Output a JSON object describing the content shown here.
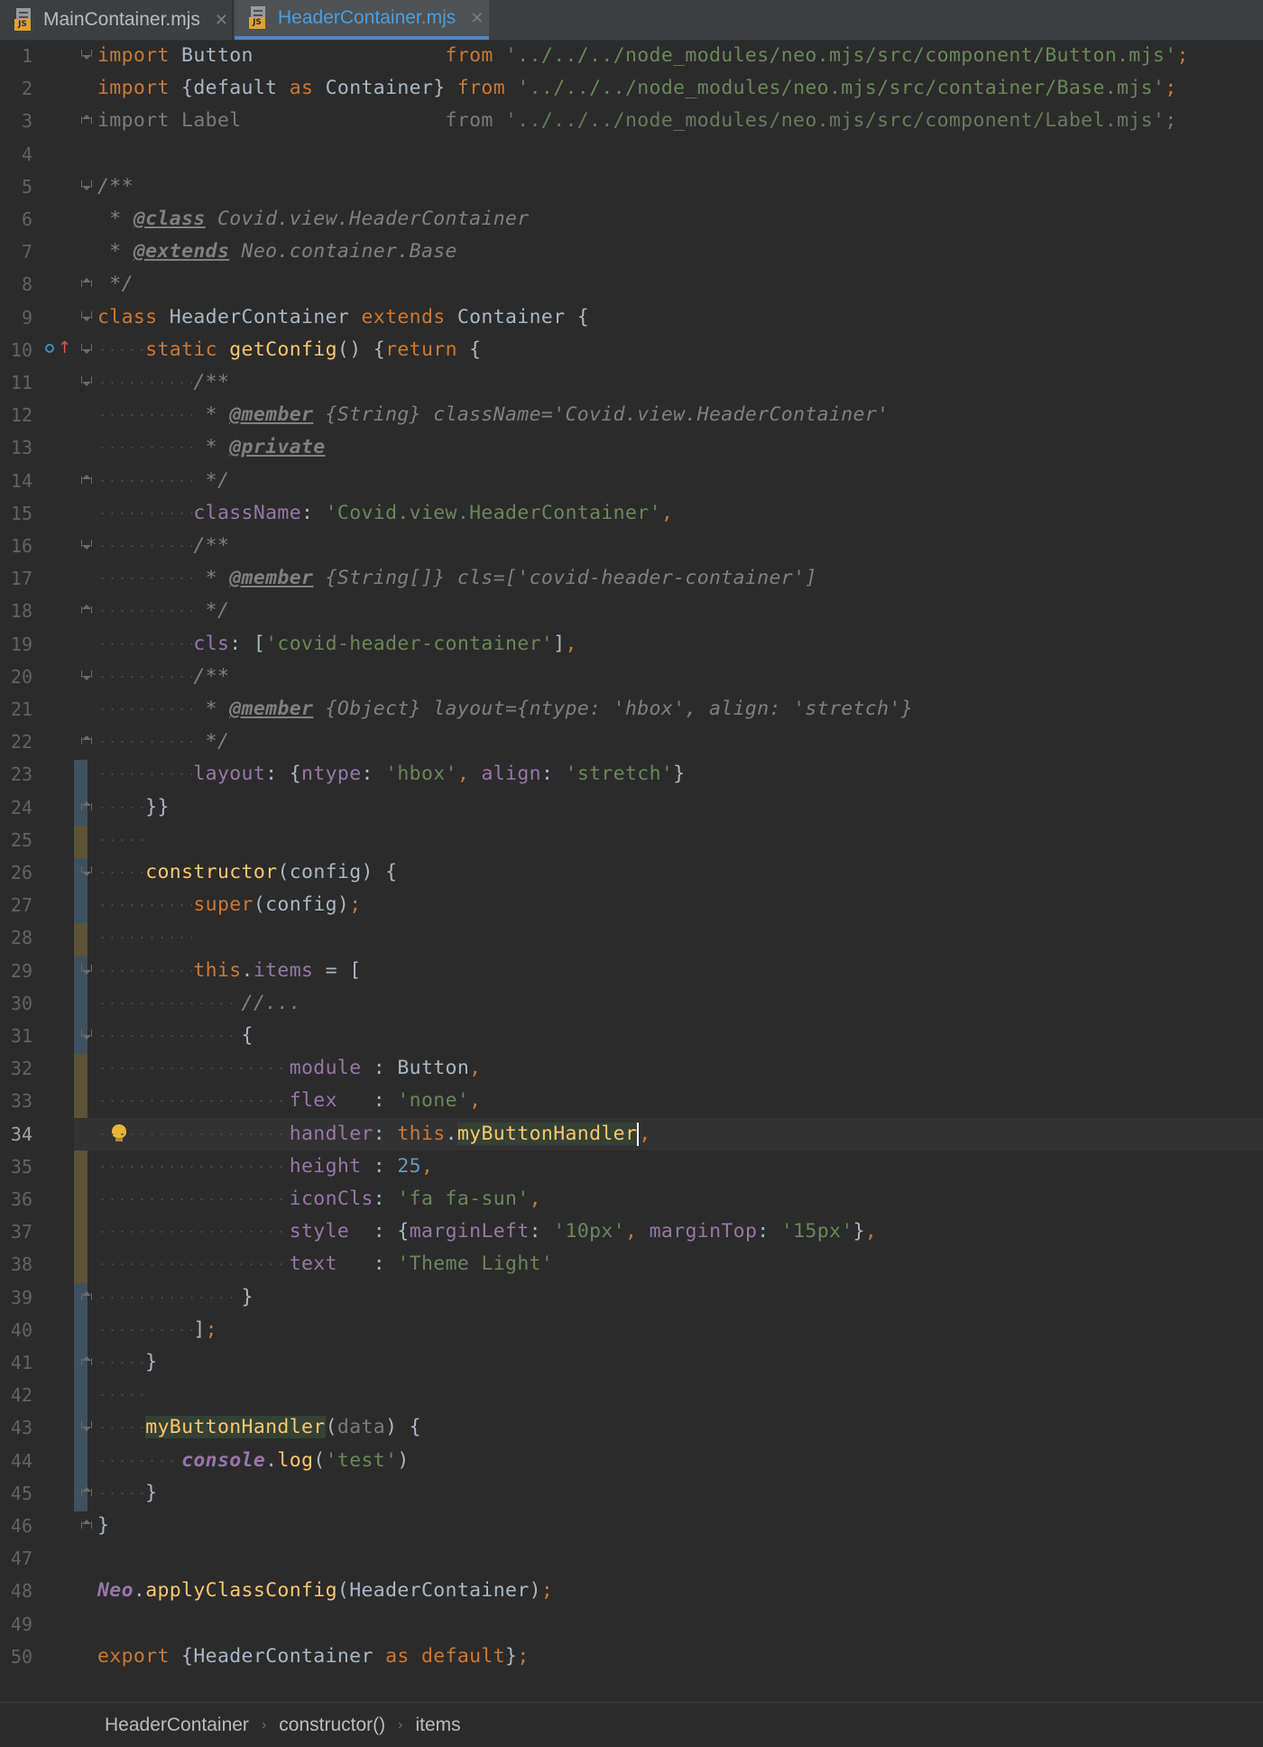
{
  "tabs": [
    {
      "label": "MainContainer.mjs",
      "icon": "js-file-icon",
      "active": false
    },
    {
      "label": "HeaderContainer.mjs",
      "icon": "js-file-icon",
      "active": true
    }
  ],
  "editor": {
    "current_line": 34,
    "line_numbers": [
      "1",
      "2",
      "3",
      "4",
      "5",
      "6",
      "7",
      "8",
      "9",
      "10",
      "11",
      "12",
      "13",
      "14",
      "15",
      "16",
      "17",
      "18",
      "19",
      "20",
      "21",
      "22",
      "23",
      "24",
      "25",
      "26",
      "27",
      "28",
      "29",
      "30",
      "31",
      "32",
      "33",
      "34",
      "35",
      "36",
      "37",
      "38",
      "39",
      "40",
      "41",
      "42",
      "43",
      "44",
      "45",
      "46",
      "47",
      "48",
      "49",
      "50"
    ],
    "lines": [
      [
        [
          "kw",
          "import"
        ],
        [
          "plain",
          " Button                "
        ],
        [
          "kw",
          "from"
        ],
        [
          "str",
          " '../../../node_modules/neo.mjs/src/component/Button.mjs'"
        ],
        [
          "kw",
          ";"
        ]
      ],
      [
        [
          "kw",
          "import"
        ],
        [
          "plain",
          " {default "
        ],
        [
          "kw",
          "as"
        ],
        [
          "plain",
          " Container} "
        ],
        [
          "kw",
          "from"
        ],
        [
          "str",
          " '../../../node_modules/neo.mjs/src/container/Base.mjs'"
        ],
        [
          "kw",
          ";"
        ]
      ],
      [
        [
          "dim",
          "import Label                 from "
        ],
        [
          "dimstr",
          "'../../../node_modules/neo.mjs/src/component/Label.mjs'"
        ],
        [
          "dim",
          ";"
        ]
      ],
      [],
      [
        [
          "cmt",
          "/**"
        ]
      ],
      [
        [
          "cmt",
          " * "
        ],
        [
          "tag",
          "@class"
        ],
        [
          "cmt",
          " Covid.view.HeaderContainer"
        ]
      ],
      [
        [
          "cmt",
          " * "
        ],
        [
          "tag",
          "@extends"
        ],
        [
          "cmt",
          " Neo.container.Base"
        ]
      ],
      [
        [
          "cmt",
          " */"
        ]
      ],
      [
        [
          "kw",
          "class"
        ],
        [
          "plain",
          " HeaderContainer "
        ],
        [
          "kw",
          "extends"
        ],
        [
          "plain",
          " Container {"
        ]
      ],
      [
        [
          "plain",
          "    "
        ],
        [
          "kw",
          "static"
        ],
        [
          "plain",
          " "
        ],
        [
          "fn",
          "getConfig"
        ],
        [
          "plain",
          "() {"
        ],
        [
          "kw",
          "return"
        ],
        [
          "plain",
          " {"
        ]
      ],
      [
        [
          "plain",
          "        "
        ],
        [
          "cmt",
          "/**"
        ]
      ],
      [
        [
          "plain",
          "        "
        ],
        [
          "cmt",
          " * "
        ],
        [
          "tag",
          "@member"
        ],
        [
          "cmt",
          " {String} className='Covid.view.HeaderContainer'"
        ]
      ],
      [
        [
          "plain",
          "        "
        ],
        [
          "cmt",
          " * "
        ],
        [
          "tag",
          "@private"
        ]
      ],
      [
        [
          "plain",
          "        "
        ],
        [
          "cmt",
          " */"
        ]
      ],
      [
        [
          "plain",
          "        "
        ],
        [
          "prop",
          "className"
        ],
        [
          "plain",
          ": "
        ],
        [
          "str",
          "'Covid.view.HeaderContainer'"
        ],
        [
          "kw",
          ","
        ]
      ],
      [
        [
          "plain",
          "        "
        ],
        [
          "cmt",
          "/**"
        ]
      ],
      [
        [
          "plain",
          "        "
        ],
        [
          "cmt",
          " * "
        ],
        [
          "tag",
          "@member"
        ],
        [
          "cmt",
          " {String[]} cls=['covid-header-container']"
        ]
      ],
      [
        [
          "plain",
          "        "
        ],
        [
          "cmt",
          " */"
        ]
      ],
      [
        [
          "plain",
          "        "
        ],
        [
          "prop",
          "cls"
        ],
        [
          "plain",
          ": ["
        ],
        [
          "str",
          "'covid-header-container'"
        ],
        [
          "plain",
          "]"
        ],
        [
          "kw",
          ","
        ]
      ],
      [
        [
          "plain",
          "        "
        ],
        [
          "cmt",
          "/**"
        ]
      ],
      [
        [
          "plain",
          "        "
        ],
        [
          "cmt",
          " * "
        ],
        [
          "tag",
          "@member"
        ],
        [
          "cmt",
          " {Object} layout={ntype: 'hbox', align: 'stretch'}"
        ]
      ],
      [
        [
          "plain",
          "        "
        ],
        [
          "cmt",
          " */"
        ]
      ],
      [
        [
          "plain",
          "        "
        ],
        [
          "prop",
          "layout"
        ],
        [
          "plain",
          ": {"
        ],
        [
          "prop",
          "ntype"
        ],
        [
          "plain",
          ": "
        ],
        [
          "str",
          "'hbox'"
        ],
        [
          "kw",
          ", "
        ],
        [
          "prop",
          "align"
        ],
        [
          "plain",
          ": "
        ],
        [
          "str",
          "'stretch'"
        ],
        [
          "plain",
          "}"
        ]
      ],
      [
        [
          "plain",
          "    }}"
        ]
      ],
      [],
      [
        [
          "plain",
          "    "
        ],
        [
          "fn",
          "constructor"
        ],
        [
          "plain",
          "(config) {"
        ]
      ],
      [
        [
          "plain",
          "        "
        ],
        [
          "kw",
          "super"
        ],
        [
          "plain",
          "(config)"
        ],
        [
          "kw",
          ";"
        ]
      ],
      [],
      [
        [
          "plain",
          "        "
        ],
        [
          "kw",
          "this"
        ],
        [
          "plain",
          "."
        ],
        [
          "prop",
          "items"
        ],
        [
          "plain",
          " = ["
        ]
      ],
      [
        [
          "plain",
          "            "
        ],
        [
          "cmt",
          "//..."
        ]
      ],
      [
        [
          "plain",
          "            {"
        ]
      ],
      [
        [
          "plain",
          "                "
        ],
        [
          "prop",
          "module"
        ],
        [
          "plain",
          " : Button"
        ],
        [
          "kw",
          ","
        ]
      ],
      [
        [
          "plain",
          "                "
        ],
        [
          "prop",
          "flex"
        ],
        [
          "plain",
          "   : "
        ],
        [
          "str",
          "'none'"
        ],
        [
          "kw",
          ","
        ]
      ],
      [
        [
          "plain",
          "                "
        ],
        [
          "prop",
          "handler"
        ],
        [
          "plain",
          ": "
        ],
        [
          "kw",
          "this"
        ],
        [
          "plain",
          "."
        ],
        [
          "fnhl",
          "myButtonHandler"
        ],
        [
          "caret",
          ""
        ],
        [
          "kw",
          ","
        ]
      ],
      [
        [
          "plain",
          "                "
        ],
        [
          "prop",
          "height"
        ],
        [
          "plain",
          " : "
        ],
        [
          "num",
          "25"
        ],
        [
          "kw",
          ","
        ]
      ],
      [
        [
          "plain",
          "                "
        ],
        [
          "prop",
          "iconCls"
        ],
        [
          "plain",
          ": "
        ],
        [
          "str",
          "'fa fa-sun'"
        ],
        [
          "kw",
          ","
        ]
      ],
      [
        [
          "plain",
          "                "
        ],
        [
          "prop",
          "style"
        ],
        [
          "plain",
          "  : {"
        ],
        [
          "prop",
          "marginLeft"
        ],
        [
          "plain",
          ": "
        ],
        [
          "str",
          "'10px'"
        ],
        [
          "kw",
          ", "
        ],
        [
          "prop",
          "marginTop"
        ],
        [
          "plain",
          ": "
        ],
        [
          "str",
          "'15px'"
        ],
        [
          "plain",
          "}"
        ],
        [
          "kw",
          ","
        ]
      ],
      [
        [
          "plain",
          "                "
        ],
        [
          "prop",
          "text"
        ],
        [
          "plain",
          "   : "
        ],
        [
          "str",
          "'Theme Light'"
        ]
      ],
      [
        [
          "plain",
          "            }"
        ]
      ],
      [
        [
          "plain",
          "        ]"
        ],
        [
          "kw",
          ";"
        ]
      ],
      [
        [
          "plain",
          "    }"
        ]
      ],
      [],
      [
        [
          "plain",
          "    "
        ],
        [
          "fnhl",
          "myButtonHandler"
        ],
        [
          "plain",
          "("
        ],
        [
          "dim",
          "data"
        ],
        [
          "plain",
          ") {"
        ]
      ],
      [
        [
          "plain",
          "       "
        ],
        [
          "gl",
          "console"
        ],
        [
          "plain",
          "."
        ],
        [
          "fn",
          "log"
        ],
        [
          "plain",
          "("
        ],
        [
          "str",
          "'test'"
        ],
        [
          "plain",
          ")"
        ]
      ],
      [
        [
          "plain",
          "    }"
        ]
      ],
      [
        [
          "plain",
          "}"
        ]
      ],
      [],
      [
        [
          "gl",
          "Neo"
        ],
        [
          "plain",
          "."
        ],
        [
          "fn",
          "applyClassConfig"
        ],
        [
          "plain",
          "(HeaderContainer)"
        ],
        [
          "kw",
          ";"
        ]
      ],
      [],
      [
        [
          "kw",
          "export"
        ],
        [
          "plain",
          " {HeaderContainer "
        ],
        [
          "kw",
          "as"
        ],
        [
          "plain",
          " "
        ],
        [
          "kw",
          "default"
        ],
        [
          "plain",
          "}"
        ],
        [
          "kw",
          ";"
        ]
      ]
    ]
  },
  "breadcrumb": [
    "HeaderContainer",
    "constructor()",
    "items"
  ]
}
